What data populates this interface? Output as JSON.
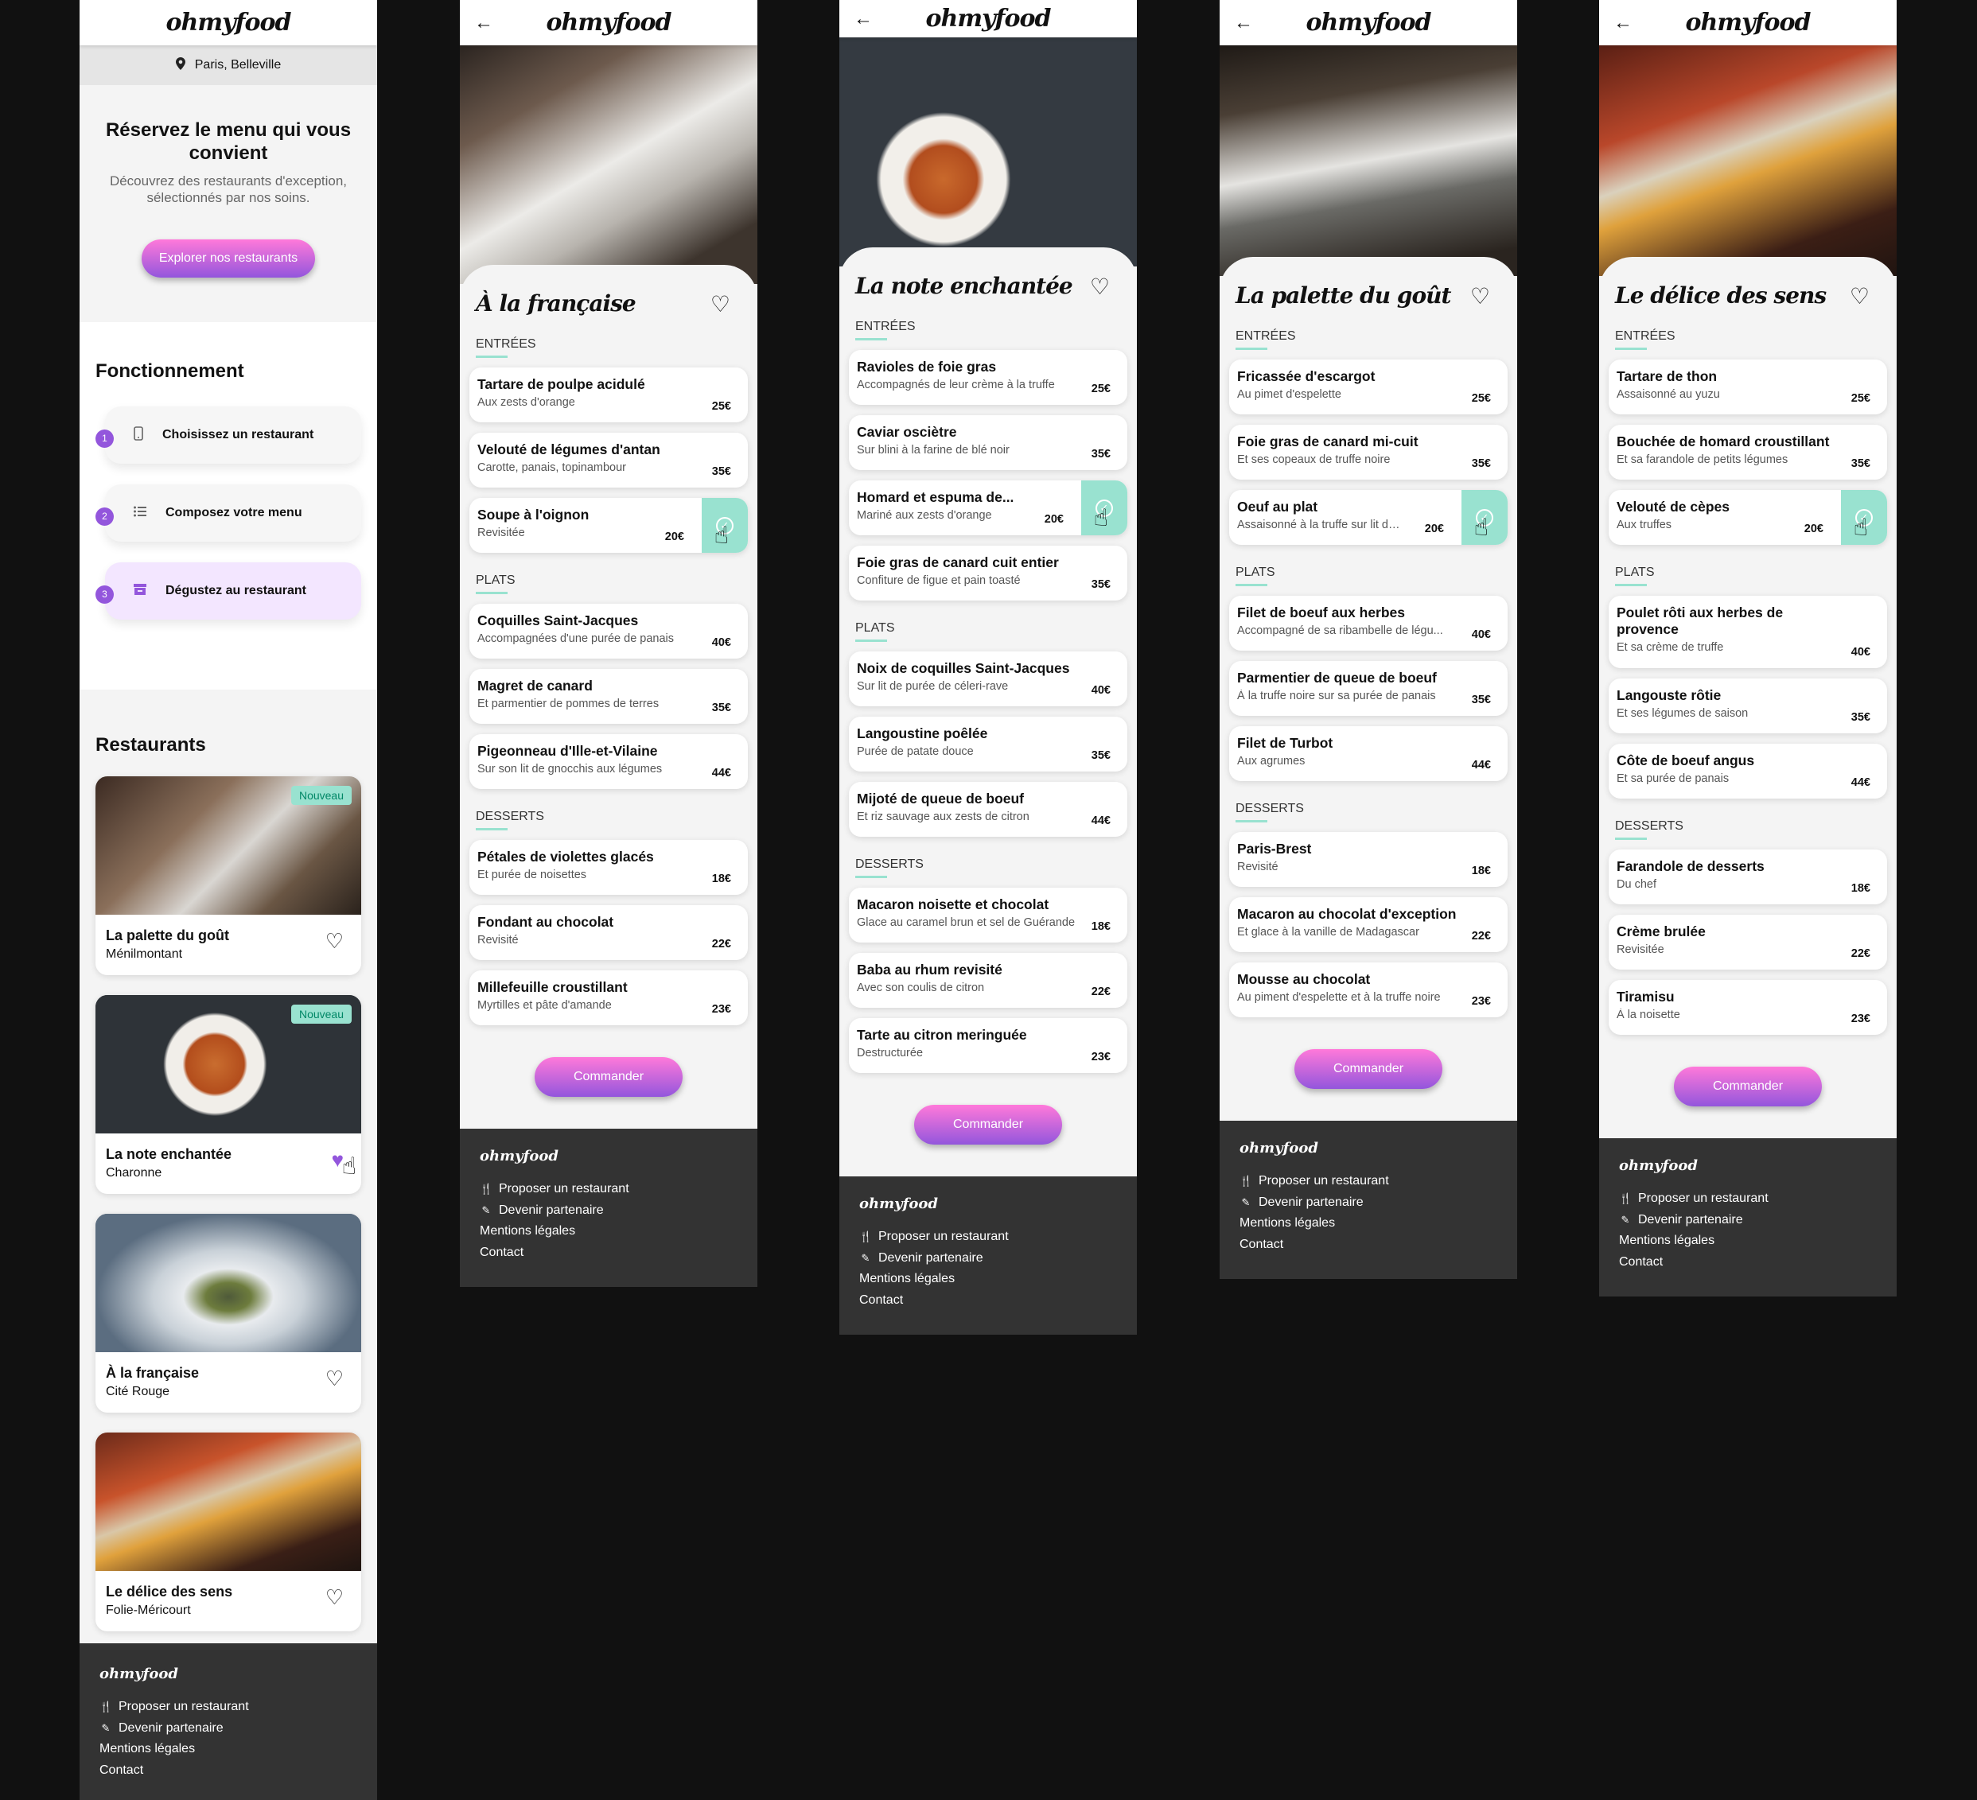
{
  "brand": "ohmyfood",
  "icons": {
    "back": "arrow-left",
    "location": "map-pin",
    "heart": "heart-outline",
    "heart_filled": "heart-filled",
    "check": "check-circle",
    "step1": "mobile-phone",
    "step2": "list",
    "step3": "store",
    "propose": "utensils",
    "partner": "handshake",
    "cursor": "hand-pointer"
  },
  "colors": {
    "primary": "#9356dc",
    "secondary": "#ff79da",
    "tertiary": "#99e2d0",
    "footer": "#333333"
  },
  "home": {
    "location": "Paris, Belleville",
    "hero_title": "Réservez le menu qui vous convient",
    "hero_text": "Découvrez des restaurants d'exception, sélectionnés par nos soins.",
    "hero_button": "Explorer nos restaurants",
    "how_title": "Fonctionnement",
    "steps": [
      {
        "num": "1",
        "label": "Choisissez un restaurant"
      },
      {
        "num": "2",
        "label": "Composez votre menu"
      },
      {
        "num": "3",
        "label": "Dégustez au restaurant"
      }
    ],
    "restaurants_title": "Restaurants",
    "restaurants": [
      {
        "name": "La palette du goût",
        "area": "Ménilmontant",
        "badge": "Nouveau"
      },
      {
        "name": "La note enchantée",
        "area": "Charonne",
        "badge": "Nouveau"
      },
      {
        "name": "À la française",
        "area": "Cité Rouge",
        "badge": ""
      },
      {
        "name": "Le délice des sens",
        "area": "Folie-Méricourt",
        "badge": ""
      }
    ]
  },
  "footer": {
    "links": [
      "Proposer un restaurant",
      "Devenir partenaire",
      "Mentions légales",
      "Contact"
    ]
  },
  "menus": [
    {
      "title": "À la française",
      "sections": [
        {
          "name": "Entrées",
          "dishes": [
            {
              "name": "Tartare de poulpe acidulé",
              "desc": "Aux zests d'orange",
              "price": "25€"
            },
            {
              "name": "Velouté de légumes d'antan",
              "desc": "Carotte, panais, topinambour",
              "price": "35€"
            },
            {
              "name": "Soupe à l'oignon",
              "desc": "Revisitée",
              "price": "20€",
              "selected": true
            }
          ]
        },
        {
          "name": "Plats",
          "dishes": [
            {
              "name": "Coquilles Saint-Jacques",
              "desc": "Accompagnées d'une purée de panais",
              "price": "40€"
            },
            {
              "name": "Magret de canard",
              "desc": "Et parmentier de pommes de terres",
              "price": "35€"
            },
            {
              "name": "Pigeonneau d'Ille-et-Vilaine",
              "desc": "Sur son lit de gnocchis aux légumes",
              "price": "44€"
            }
          ]
        },
        {
          "name": "Desserts",
          "dishes": [
            {
              "name": "Pétales de violettes glacés",
              "desc": "Et purée de noisettes",
              "price": "18€"
            },
            {
              "name": "Fondant au chocolat",
              "desc": "Revisité",
              "price": "22€"
            },
            {
              "name": "Millefeuille croustillant",
              "desc": "Myrtilles et pâte d'amande",
              "price": "23€"
            }
          ]
        }
      ],
      "button": "Commander"
    },
    {
      "title": "La note enchantée",
      "sections": [
        {
          "name": "Entrées",
          "dishes": [
            {
              "name": "Ravioles de foie gras",
              "desc": "Accompagnés de leur crème à la truffe",
              "price": "25€"
            },
            {
              "name": "Caviar osciètre",
              "desc": "Sur blini à la farine de blé noir",
              "price": "35€"
            },
            {
              "name": "Homard et espuma de...",
              "desc": "Mariné aux zests d'orange",
              "price": "20€",
              "selected": true
            },
            {
              "name": "Foie gras de canard cuit entier",
              "desc": "Confiture de figue et pain toasté",
              "price": "35€"
            }
          ]
        },
        {
          "name": "Plats",
          "dishes": [
            {
              "name": "Noix de coquilles Saint-Jacques",
              "desc": "Sur lit de purée de céleri-rave",
              "price": "40€"
            },
            {
              "name": "Langoustine poêlée",
              "desc": "Purée de patate douce",
              "price": "35€"
            },
            {
              "name": "Mijoté de queue de boeuf",
              "desc": "Et riz sauvage aux zests de citron",
              "price": "44€"
            }
          ]
        },
        {
          "name": "Desserts",
          "dishes": [
            {
              "name": "Macaron noisette et chocolat",
              "desc": "Glace au caramel brun et sel de Guérande",
              "price": "18€"
            },
            {
              "name": "Baba au rhum revisité",
              "desc": "Avec son coulis de citron",
              "price": "22€"
            },
            {
              "name": "Tarte au citron meringuée",
              "desc": "Destructurée",
              "price": "23€"
            }
          ]
        }
      ],
      "button": "Commander"
    },
    {
      "title": "La palette du goût",
      "sections": [
        {
          "name": "Entrées",
          "dishes": [
            {
              "name": "Fricassée d'escargot",
              "desc": "Au pimet d'espelette",
              "price": "25€"
            },
            {
              "name": "Foie gras de canard mi-cuit",
              "desc": "Et ses copeaux de truffe noire",
              "price": "35€"
            },
            {
              "name": "Oeuf au plat",
              "desc": "Assaisonné à la truffe sur lit de...",
              "price": "20€",
              "selected": true
            }
          ]
        },
        {
          "name": "Plats",
          "dishes": [
            {
              "name": "Filet de boeuf aux herbes",
              "desc": "Accompagné de sa ribambelle de légu...",
              "price": "40€"
            },
            {
              "name": "Parmentier de queue de boeuf",
              "desc": "À la truffe noire sur sa purée de panais",
              "price": "35€"
            },
            {
              "name": "Filet de Turbot",
              "desc": "Aux agrumes",
              "price": "44€"
            }
          ]
        },
        {
          "name": "Desserts",
          "dishes": [
            {
              "name": "Paris-Brest",
              "desc": "Revisité",
              "price": "18€"
            },
            {
              "name": "Macaron au chocolat d'exception",
              "desc": "Et glace à la vanille de Madagascar",
              "price": "22€"
            },
            {
              "name": "Mousse au chocolat",
              "desc": "Au piment d'espelette et à la truffe noire",
              "price": "23€"
            }
          ]
        }
      ],
      "button": "Commander"
    },
    {
      "title": "Le délice des sens",
      "sections": [
        {
          "name": "Entrées",
          "dishes": [
            {
              "name": "Tartare de thon",
              "desc": "Assaisonné au yuzu",
              "price": "25€"
            },
            {
              "name": "Bouchée de homard croustillant",
              "desc": "Et sa farandole de petits légumes",
              "price": "35€"
            },
            {
              "name": "Velouté de cèpes",
              "desc": "Aux truffes",
              "price": "20€",
              "selected": true
            }
          ]
        },
        {
          "name": "Plats",
          "dishes": [
            {
              "name": "Poulet rôti aux herbes de provence",
              "desc": "Et sa crème de truffe",
              "price": "40€",
              "tall": true
            },
            {
              "name": "Langouste rôtie",
              "desc": "Et ses légumes de saison",
              "price": "35€"
            },
            {
              "name": "Côte de boeuf angus",
              "desc": "Et sa purée de panais",
              "price": "44€"
            }
          ]
        },
        {
          "name": "Desserts",
          "dishes": [
            {
              "name": "Farandole de desserts",
              "desc": "Du chef",
              "price": "18€"
            },
            {
              "name": "Crème brulée",
              "desc": "Revisitée",
              "price": "22€"
            },
            {
              "name": "Tiramisu",
              "desc": "À la noisette",
              "price": "23€"
            }
          ]
        }
      ],
      "button": "Commander"
    }
  ]
}
